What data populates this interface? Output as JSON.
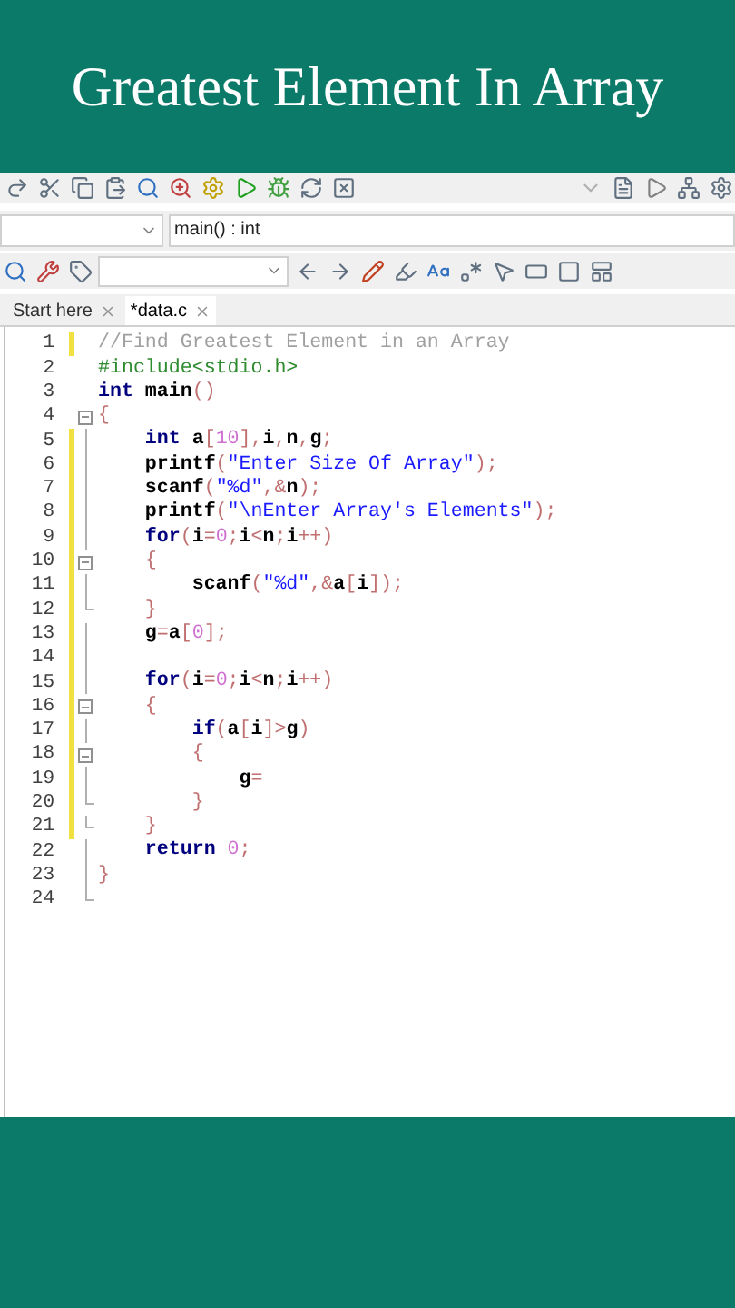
{
  "title": "Greatest Element In Array",
  "ide": {
    "scope_field": {
      "value": "main() : int"
    },
    "tabs": [
      {
        "label": "Start here",
        "selected": false
      },
      {
        "label": "*data.c",
        "selected": true
      }
    ],
    "lines": [
      {
        "number": "1",
        "changed": true,
        "fold_box": false,
        "fold_line": false,
        "fold_end": false,
        "tokens": [
          {
            "text": "//Find Greatest Element in an Array",
            "kind": "comment"
          }
        ]
      },
      {
        "number": "2",
        "changed": false,
        "fold_box": false,
        "fold_line": false,
        "fold_end": false,
        "tokens": [
          {
            "text": "#include<stdio.h>",
            "kind": "pre"
          }
        ]
      },
      {
        "number": "3",
        "changed": false,
        "fold_box": false,
        "fold_line": false,
        "fold_end": false,
        "tokens": [
          {
            "text": "int",
            "kind": "kw"
          },
          {
            "text": " main",
            "kind": "id"
          },
          {
            "text": "()",
            "kind": "op"
          }
        ]
      },
      {
        "number": "4",
        "changed": false,
        "fold_box": true,
        "fold_line": false,
        "fold_end": false,
        "tokens": [
          {
            "text": "{",
            "kind": "op"
          }
        ]
      },
      {
        "number": "5",
        "changed": true,
        "fold_box": false,
        "fold_line": true,
        "fold_end": false,
        "tokens": [
          {
            "text": "    int",
            "kind": "kw"
          },
          {
            "text": " a",
            "kind": "id"
          },
          {
            "text": "[",
            "kind": "op"
          },
          {
            "text": "10",
            "kind": "num"
          },
          {
            "text": "],",
            "kind": "op"
          },
          {
            "text": "i",
            "kind": "id"
          },
          {
            "text": ",",
            "kind": "op"
          },
          {
            "text": "n",
            "kind": "id"
          },
          {
            "text": ",",
            "kind": "op"
          },
          {
            "text": "g",
            "kind": "id"
          },
          {
            "text": ";",
            "kind": "op"
          }
        ]
      },
      {
        "number": "6",
        "changed": true,
        "fold_box": false,
        "fold_line": true,
        "fold_end": false,
        "tokens": [
          {
            "text": "    printf",
            "kind": "id"
          },
          {
            "text": "(",
            "kind": "op"
          },
          {
            "text": "\"Enter Size Of Array\"",
            "kind": "str"
          },
          {
            "text": ");",
            "kind": "op"
          }
        ]
      },
      {
        "number": "7",
        "changed": true,
        "fold_box": false,
        "fold_line": true,
        "fold_end": false,
        "tokens": [
          {
            "text": "    scanf",
            "kind": "id"
          },
          {
            "text": "(",
            "kind": "op"
          },
          {
            "text": "\"%d\"",
            "kind": "str"
          },
          {
            "text": ",&",
            "kind": "op"
          },
          {
            "text": "n",
            "kind": "id"
          },
          {
            "text": ");",
            "kind": "op"
          }
        ]
      },
      {
        "number": "8",
        "changed": true,
        "fold_box": false,
        "fold_line": true,
        "fold_end": false,
        "tokens": [
          {
            "text": "    printf",
            "kind": "id"
          },
          {
            "text": "(",
            "kind": "op"
          },
          {
            "text": "\"\\nEnter Array's Elements\"",
            "kind": "str"
          },
          {
            "text": ");",
            "kind": "op"
          }
        ]
      },
      {
        "number": "9",
        "changed": true,
        "fold_box": false,
        "fold_line": true,
        "fold_end": false,
        "tokens": [
          {
            "text": "    for",
            "kind": "kw"
          },
          {
            "text": "(",
            "kind": "op"
          },
          {
            "text": "i",
            "kind": "id"
          },
          {
            "text": "=",
            "kind": "op"
          },
          {
            "text": "0",
            "kind": "num"
          },
          {
            "text": ";",
            "kind": "op"
          },
          {
            "text": "i",
            "kind": "id"
          },
          {
            "text": "<",
            "kind": "op"
          },
          {
            "text": "n",
            "kind": "id"
          },
          {
            "text": ";",
            "kind": "op"
          },
          {
            "text": "i",
            "kind": "id"
          },
          {
            "text": "++)",
            "kind": "op"
          }
        ]
      },
      {
        "number": "10",
        "changed": true,
        "fold_box": true,
        "fold_line": false,
        "fold_end": false,
        "tokens": [
          {
            "text": "    {",
            "kind": "op"
          }
        ]
      },
      {
        "number": "11",
        "changed": true,
        "fold_box": false,
        "fold_line": true,
        "fold_end": false,
        "tokens": [
          {
            "text": "        scanf",
            "kind": "id"
          },
          {
            "text": "(",
            "kind": "op"
          },
          {
            "text": "\"%d\"",
            "kind": "str"
          },
          {
            "text": ",&",
            "kind": "op"
          },
          {
            "text": "a",
            "kind": "id"
          },
          {
            "text": "[",
            "kind": "op"
          },
          {
            "text": "i",
            "kind": "id"
          },
          {
            "text": "]);",
            "kind": "op"
          }
        ]
      },
      {
        "number": "12",
        "changed": true,
        "fold_box": false,
        "fold_line": false,
        "fold_end": true,
        "tokens": [
          {
            "text": "    }",
            "kind": "op"
          }
        ]
      },
      {
        "number": "13",
        "changed": true,
        "fold_box": false,
        "fold_line": true,
        "fold_end": false,
        "tokens": [
          {
            "text": "    g",
            "kind": "id"
          },
          {
            "text": "=",
            "kind": "op"
          },
          {
            "text": "a",
            "kind": "id"
          },
          {
            "text": "[",
            "kind": "op"
          },
          {
            "text": "0",
            "kind": "num"
          },
          {
            "text": "];",
            "kind": "op"
          }
        ]
      },
      {
        "number": "14",
        "changed": true,
        "fold_box": false,
        "fold_line": true,
        "fold_end": false
      },
      {
        "number": "15",
        "changed": true,
        "fold_box": false,
        "fold_line": true,
        "fold_end": false,
        "tokens": [
          {
            "text": "    for",
            "kind": "kw"
          },
          {
            "text": "(",
            "kind": "op"
          },
          {
            "text": "i",
            "kind": "id"
          },
          {
            "text": "=",
            "kind": "op"
          },
          {
            "text": "0",
            "kind": "num"
          },
          {
            "text": ";",
            "kind": "op"
          },
          {
            "text": "i",
            "kind": "id"
          },
          {
            "text": "<",
            "kind": "op"
          },
          {
            "text": "n",
            "kind": "id"
          },
          {
            "text": ";",
            "kind": "op"
          },
          {
            "text": "i",
            "kind": "id"
          },
          {
            "text": "++)",
            "kind": "op"
          }
        ]
      },
      {
        "number": "16",
        "changed": true,
        "fold_box": true,
        "fold_line": false,
        "fold_end": false,
        "tokens": [
          {
            "text": "    {",
            "kind": "op"
          }
        ]
      },
      {
        "number": "17",
        "changed": true,
        "fold_box": false,
        "fold_line": true,
        "fold_end": false,
        "tokens": [
          {
            "text": "        if",
            "kind": "kw"
          },
          {
            "text": "(",
            "kind": "op"
          },
          {
            "text": "a",
            "kind": "id"
          },
          {
            "text": "[",
            "kind": "op"
          },
          {
            "text": "i",
            "kind": "id"
          },
          {
            "text": "]>",
            "kind": "op"
          },
          {
            "text": "g",
            "kind": "id"
          },
          {
            "text": ")",
            "kind": "op"
          }
        ]
      },
      {
        "number": "18",
        "changed": true,
        "fold_box": true,
        "fold_line": false,
        "fold_end": false,
        "tokens": [
          {
            "text": "        {",
            "kind": "op"
          }
        ]
      },
      {
        "number": "19",
        "changed": true,
        "fold_box": false,
        "fold_line": true,
        "fold_end": false,
        "tokens": [
          {
            "text": "            g",
            "kind": "id"
          },
          {
            "text": "=",
            "kind": "op"
          }
        ]
      },
      {
        "number": "20",
        "changed": true,
        "fold_box": false,
        "fold_line": false,
        "fold_end": true,
        "tokens": [
          {
            "text": "        }",
            "kind": "op"
          }
        ]
      },
      {
        "number": "21",
        "changed": true,
        "fold_box": false,
        "fold_line": false,
        "fold_end": true,
        "tokens": [
          {
            "text": "    }",
            "kind": "op"
          }
        ]
      },
      {
        "number": "22",
        "changed": false,
        "fold_box": false,
        "fold_line": true,
        "fold_end": false,
        "tokens": [
          {
            "text": "    return",
            "kind": "kw"
          },
          {
            "text": " 0",
            "kind": "num"
          },
          {
            "text": ";",
            "kind": "op"
          }
        ]
      },
      {
        "number": "23",
        "changed": false,
        "fold_box": false,
        "fold_line": true,
        "fold_end": false,
        "tokens": [
          {
            "text": "}",
            "kind": "op"
          }
        ]
      },
      {
        "number": "24",
        "changed": false,
        "fold_box": false,
        "fold_line": false,
        "fold_end": true
      }
    ]
  }
}
